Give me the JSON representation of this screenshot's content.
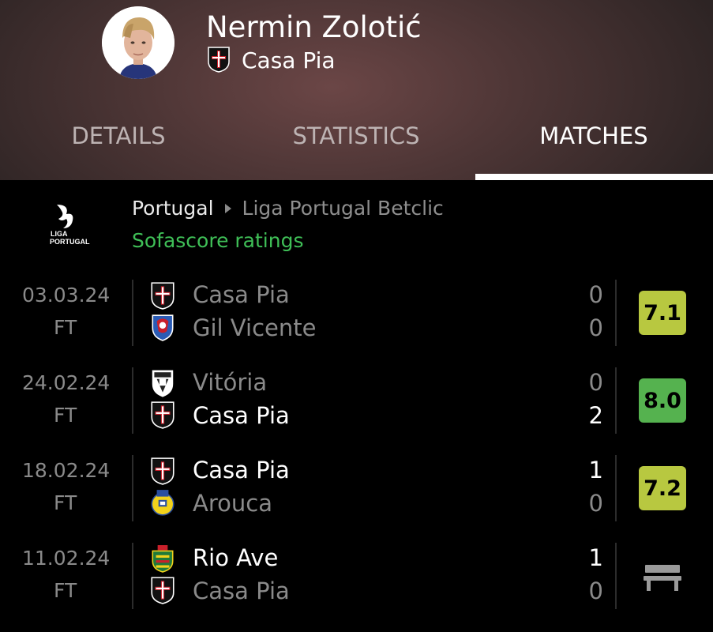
{
  "player": {
    "name": "Nermin Zolotić",
    "team": "Casa Pia"
  },
  "tabs": [
    {
      "label": "DETAILS",
      "active": false
    },
    {
      "label": "STATISTICS",
      "active": false
    },
    {
      "label": "MATCHES",
      "active": true
    }
  ],
  "league": {
    "logo_text_line1": "LIGA",
    "logo_text_line2": "PORTUGAL",
    "country": "Portugal",
    "name": "Liga Portugal Betclic",
    "ratings_label": "Sofascore ratings"
  },
  "colors": {
    "rating_yellow_green": "#b8c840",
    "rating_green": "#55b24f",
    "ratings_label": "#3fbf57"
  },
  "matches": [
    {
      "date": "03.03.24",
      "status": "FT",
      "home": {
        "name": "Casa Pia",
        "crest": "casa-pia-crest",
        "score": "0",
        "winner": false
      },
      "away": {
        "name": "Gil Vicente",
        "crest": "gil-vicente-crest",
        "score": "0",
        "winner": false
      },
      "rating": "7.1",
      "rating_color": "#b8c840"
    },
    {
      "date": "24.02.24",
      "status": "FT",
      "home": {
        "name": "Vitória",
        "crest": "vitoria-crest",
        "score": "0",
        "winner": false
      },
      "away": {
        "name": "Casa Pia",
        "crest": "casa-pia-crest",
        "score": "2",
        "winner": true
      },
      "rating": "8.0",
      "rating_color": "#55b24f"
    },
    {
      "date": "18.02.24",
      "status": "FT",
      "home": {
        "name": "Casa Pia",
        "crest": "casa-pia-crest",
        "score": "1",
        "winner": true
      },
      "away": {
        "name": "Arouca",
        "crest": "arouca-crest",
        "score": "0",
        "winner": false
      },
      "rating": "7.2",
      "rating_color": "#b8c840"
    },
    {
      "date": "11.02.24",
      "status": "FT",
      "home": {
        "name": "Rio Ave",
        "crest": "rio-ave-crest",
        "score": "1",
        "winner": true
      },
      "away": {
        "name": "Casa Pia",
        "crest": "casa-pia-crest",
        "score": "0",
        "winner": false
      },
      "rating": null,
      "bench_icon": "bench-icon"
    }
  ]
}
